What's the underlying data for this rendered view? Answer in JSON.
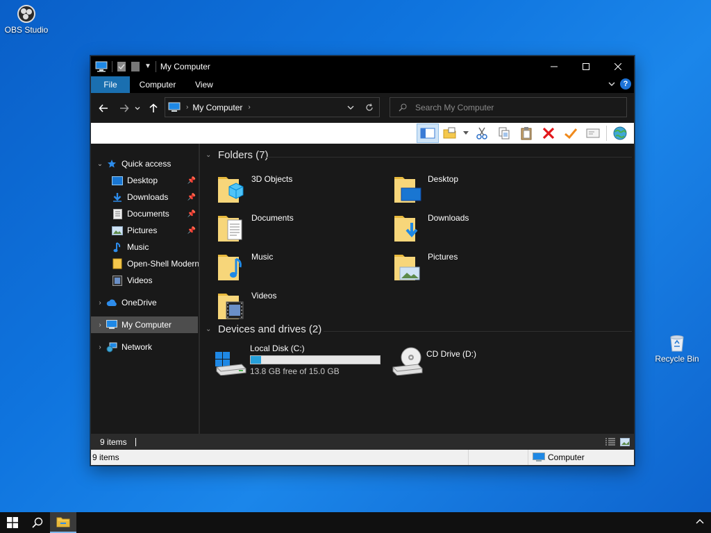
{
  "desktop": {
    "icons": [
      {
        "label": "OBS Studio",
        "icon": "obs-studio-icon"
      },
      {
        "label": "Recycle Bin",
        "icon": "recycle-bin-icon"
      }
    ]
  },
  "window": {
    "title": "My Computer",
    "ribbon_tabs": [
      "File",
      "Computer",
      "View"
    ],
    "address": {
      "crumb": "My Computer"
    },
    "search": {
      "placeholder": "Search My Computer"
    }
  },
  "nav_pane": {
    "quick_access": "Quick access",
    "quick_items": [
      {
        "label": "Desktop",
        "pinned": true
      },
      {
        "label": "Downloads",
        "pinned": true
      },
      {
        "label": "Documents",
        "pinned": true
      },
      {
        "label": "Pictures",
        "pinned": true
      },
      {
        "label": "Music",
        "pinned": false
      },
      {
        "label": "Open-Shell Modern",
        "pinned": false
      },
      {
        "label": "Videos",
        "pinned": false
      }
    ],
    "onedrive": "OneDrive",
    "my_computer": "My Computer",
    "network": "Network"
  },
  "content": {
    "folders_header": "Folders (7)",
    "folders": [
      "3D Objects",
      "Desktop",
      "Documents",
      "Downloads",
      "Music",
      "Pictures",
      "Videos"
    ],
    "drives_header": "Devices and drives (2)",
    "drives": [
      {
        "name": "Local Disk (C:)",
        "free_text": "13.8 GB free of 15.0 GB",
        "used_fraction": 0.08
      },
      {
        "name": "CD Drive (D:)"
      }
    ]
  },
  "details_bar": {
    "count": "9 items"
  },
  "status_bar": {
    "count": "9 items",
    "location": "Computer"
  },
  "colors": {
    "accent": "#1a6fb0",
    "selection": "#4d4d4d",
    "drive_bar": "#26a0da"
  }
}
